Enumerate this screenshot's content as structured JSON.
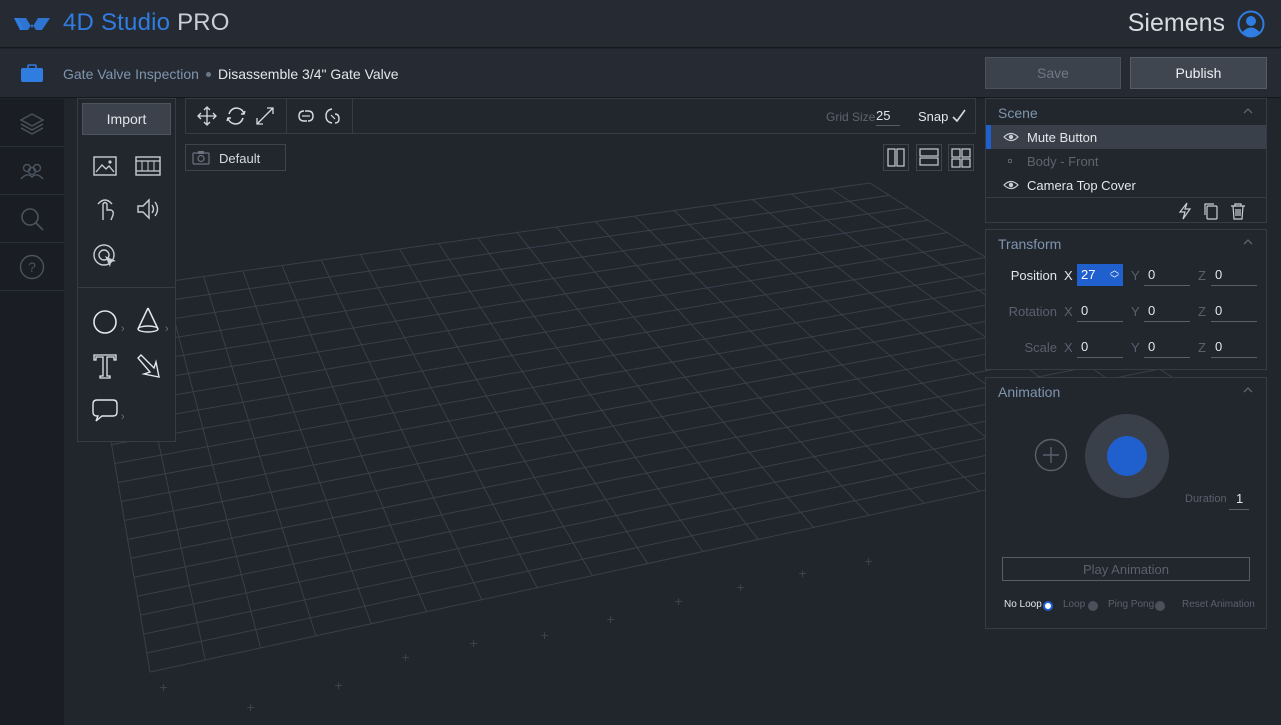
{
  "app": {
    "title_main": "4D Studio",
    "title_suffix": " PRO",
    "logo": "4d-studio-logo"
  },
  "user": {
    "name": "Siemens",
    "icon": "user-avatar-icon"
  },
  "breadcrumb": {
    "project": "Gate Valve Inspection",
    "current": "Disassemble 3/4\" Gate Valve",
    "icon": "briefcase-icon"
  },
  "actions": {
    "save_label": "Save",
    "publish_label": "Publish"
  },
  "leftnav": {
    "items": [
      "layers-icon",
      "users-icon",
      "search-icon",
      "help-icon"
    ]
  },
  "palette": {
    "import_label": "Import",
    "media_tools": [
      "image-icon",
      "video-icon",
      "touch-icon",
      "audio-icon",
      "hotspot-icon"
    ],
    "shape_tools": [
      "circle-icon",
      "cone-icon",
      "text-icon",
      "arrow-icon",
      "callout-icon"
    ]
  },
  "toolbar": {
    "tools": [
      "move-icon",
      "rotate-icon",
      "scale-icon",
      "link-icon",
      "unlink-icon"
    ],
    "grid_size_label": "Grid Size",
    "grid_size_value": "25",
    "snap_label": "Snap",
    "snap_enabled": true
  },
  "camera": {
    "label": "Default",
    "icon": "camera-icon"
  },
  "layouts": [
    "split-vertical-icon",
    "split-horizontal-icon",
    "quad-view-icon"
  ],
  "scene": {
    "title": "Scene",
    "items": [
      {
        "label": "Mute Button",
        "visible": true,
        "selected": true
      },
      {
        "label": "Body - Front",
        "visible": false,
        "selected": false
      },
      {
        "label": "Camera Top Cover",
        "visible": true,
        "selected": false
      }
    ],
    "actions": [
      "lightning-icon",
      "duplicate-icon",
      "trash-icon"
    ]
  },
  "transform": {
    "title": "Transform",
    "position": {
      "label": "Position",
      "x": "27",
      "y": "0",
      "z": "0"
    },
    "rotation": {
      "label": "Rotation",
      "x": "0",
      "y": "0",
      "z": "0"
    },
    "scale": {
      "label": "Scale",
      "x": "0",
      "y": "0",
      "z": "0"
    },
    "axis_x": "X",
    "axis_y": "Y",
    "axis_z": "Z"
  },
  "animation": {
    "title": "Animation",
    "duration_label": "Duration",
    "duration_value": "1",
    "play_label": "Play Animation",
    "loop_options": [
      "No Loop",
      "Loop",
      "Ping Pong"
    ],
    "selected_loop": "No Loop",
    "reset_label": "Reset Animation"
  },
  "colors": {
    "accent": "#1f5fce",
    "brand": "#2f7de1",
    "background": "#1f242b"
  }
}
